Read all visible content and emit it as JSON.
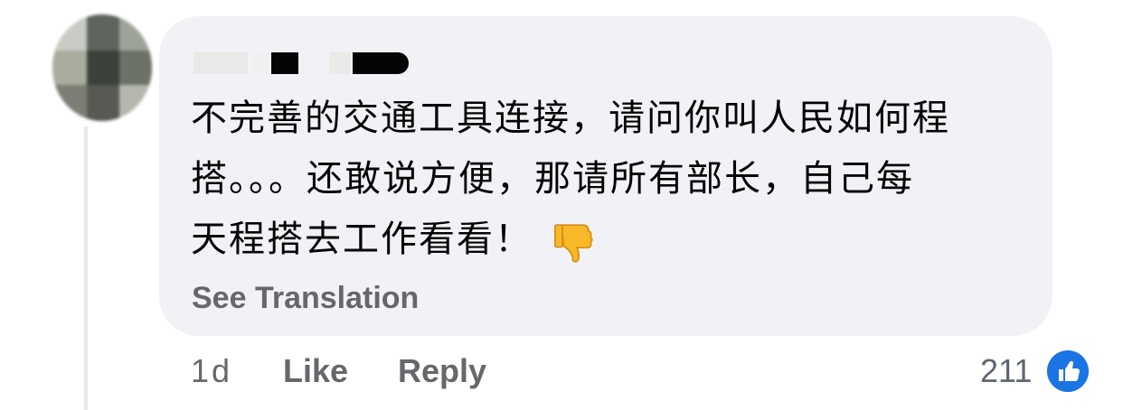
{
  "comment": {
    "author_name": "",
    "text_lines": [
      "不完善的交通工具连接，请问你叫人民如何程",
      "搭。。。还敢说方便，那请所有部长，自己每",
      "天程搭去工作看看！"
    ],
    "emoji": "thumbs-down-icon",
    "see_translation_label": "See Translation"
  },
  "actions": {
    "time": "1d",
    "like_label": "Like",
    "reply_label": "Reply",
    "reaction_count": "211",
    "reaction_icon": "like-icon"
  },
  "colors": {
    "bubble": "#f0f2f5",
    "text": "#050505",
    "secondary": "#65676b",
    "like_badge": "#1b74e4",
    "emoji": "#f7b928"
  }
}
